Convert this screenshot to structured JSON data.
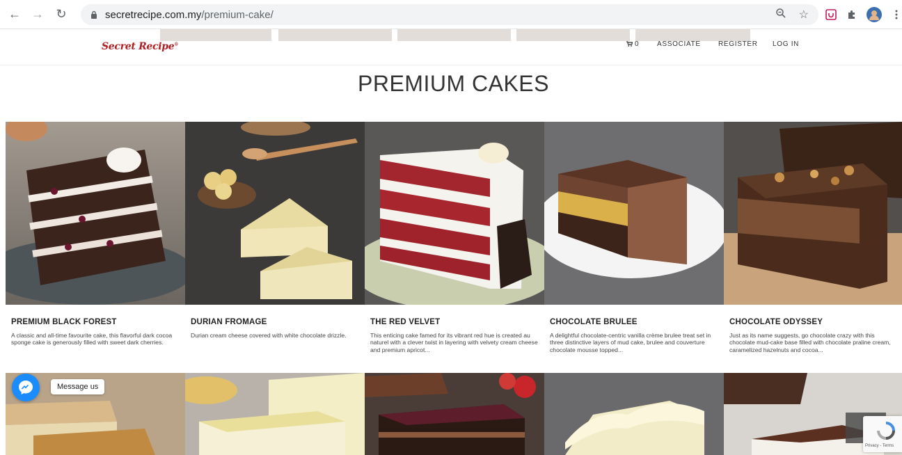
{
  "browser": {
    "url_domain": "secretrecipe.com.my",
    "url_path": "/premium-cake/"
  },
  "header": {
    "logo_text": "Secret Recipe",
    "logo_mark": "®",
    "cart_count": "0",
    "menu": [
      "ASSOCIATE",
      "REGISTER",
      "LOG IN"
    ]
  },
  "page": {
    "title": "PREMIUM CAKES"
  },
  "products": [
    {
      "name": "PREMIUM BLACK FOREST",
      "desc": "A classic and all-time favourite cake, this flavorful dark cocoa sponge cake is generously filled with sweet dark cherries."
    },
    {
      "name": "DURIAN FROMAGE",
      "desc": "Durian cream cheese covered with white chocolate drizzle."
    },
    {
      "name": "THE RED VELVET",
      "desc": "This enticing cake famed for its vibrant red hue is created au naturel with a clever twist in layering with velvety cream cheese and premium apricot..."
    },
    {
      "name": "CHOCOLATE BRULEE",
      "desc": "A delightful chocolate-centric vanilla crème brulee treat set in three distinctive layers of mud cake, brulee and couverture chocolate mousse topped..."
    },
    {
      "name": "CHOCOLATE ODYSSEY",
      "desc": "Just as its name suggests, go chocolate crazy with this chocolate mud-cake base filled with chocolate praline cream, caramelized hazelnuts and cocoa..."
    }
  ],
  "widgets": {
    "messenger_label": "Message us",
    "recaptcha_terms": "Privacy - Terms"
  },
  "colors": {
    "brand": "#b01e23",
    "messenger": "#1a8cff"
  }
}
